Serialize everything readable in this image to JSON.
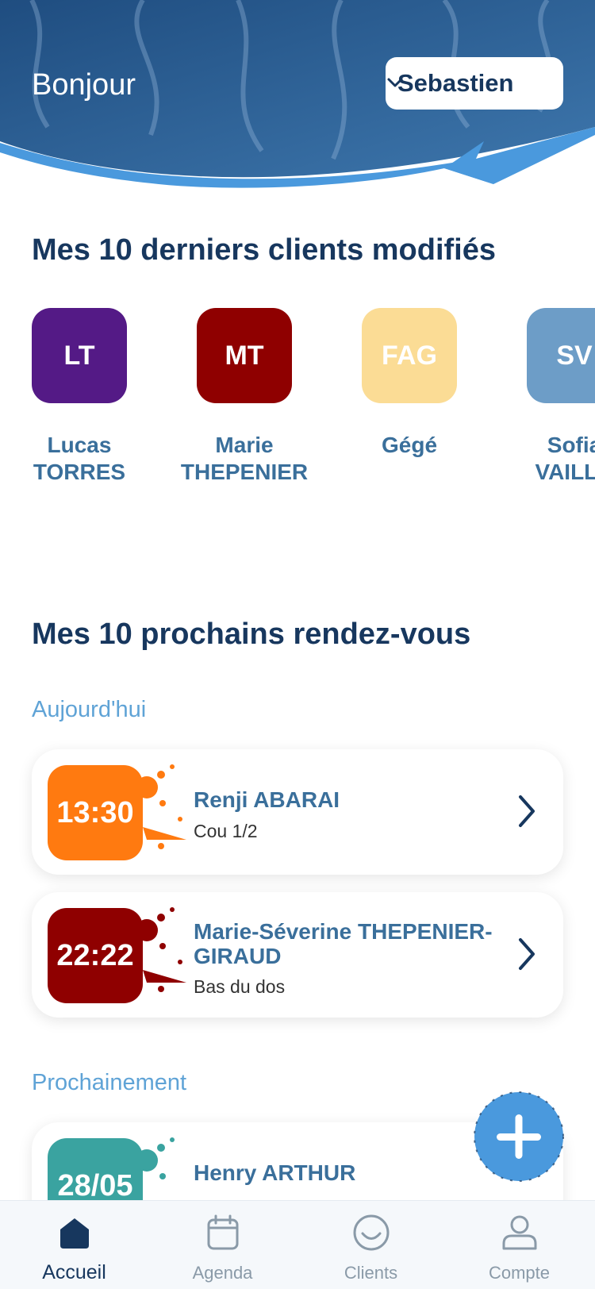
{
  "header": {
    "greeting": "Bonjour",
    "user": {
      "name": "Sebastien",
      "icon": "chevron-down-icon"
    }
  },
  "recent_clients": {
    "title": "Mes 10 derniers clients modifiés",
    "items": [
      {
        "initials": "LT",
        "name_line1": "Lucas",
        "name_line2": "TORRES",
        "color": "#541a86"
      },
      {
        "initials": "MT",
        "name_line1": "Marie",
        "name_line2": "THEPENIER",
        "color": "#8f0000"
      },
      {
        "initials": "FAG",
        "name_line1": "Gégé",
        "name_line2": "",
        "color": "#fbdc95"
      },
      {
        "initials": "SV",
        "name_line1": "Sofia",
        "name_line2": "VAILLA",
        "color": "#6d9dc7"
      }
    ]
  },
  "appointments": {
    "title": "Mes 10 prochains rendez-vous",
    "today_label": "Aujourd'hui",
    "next_label": "Prochainement",
    "today": [
      {
        "time": "13:30",
        "name": "Renji ABARAI",
        "zone": "Cou 1/2",
        "color": "#ff7a10"
      },
      {
        "time": "22:22",
        "name": "Marie-Séverine THEPENIER-GIRAUD",
        "zone": "Bas du dos",
        "color": "#8f0000"
      }
    ],
    "upcoming": [
      {
        "time": "28/05",
        "name": "Henry ARTHUR",
        "zone": "",
        "color": "#3aa3a0"
      }
    ]
  },
  "fab": {
    "icon": "plus-icon"
  },
  "nav": {
    "items": [
      {
        "label": "Accueil",
        "icon": "home-icon",
        "active": true
      },
      {
        "label": "Agenda",
        "icon": "calendar-icon",
        "active": false
      },
      {
        "label": "Clients",
        "icon": "smiley-icon",
        "active": false
      },
      {
        "label": "Compte",
        "icon": "user-icon",
        "active": false
      }
    ]
  },
  "colors": {
    "primary": "#17375e",
    "accent": "#4a99dd",
    "muted": "#8a9aa8"
  }
}
